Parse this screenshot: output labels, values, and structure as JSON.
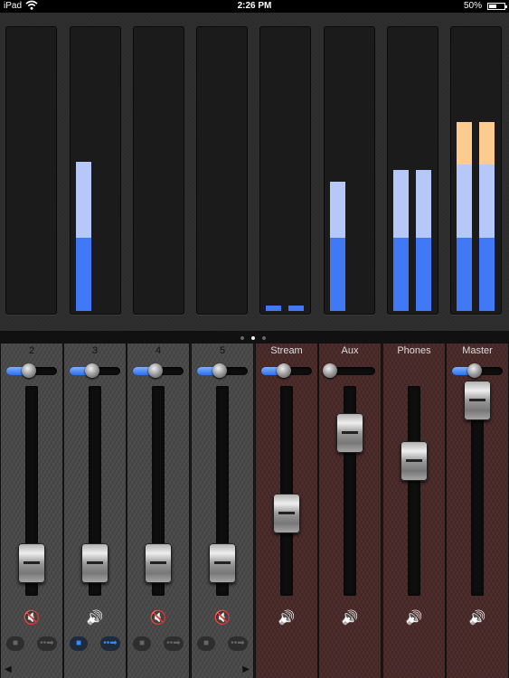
{
  "status_bar": {
    "carrier": "iPad",
    "wifi_icon": "wifi-icon",
    "time": "2:26 PM",
    "battery_pct": "50%"
  },
  "meters": [
    {
      "bars": []
    },
    {
      "bars": [
        {
          "low": 0.26,
          "mid": 0.27,
          "high": 0
        }
      ]
    },
    {
      "bars": []
    },
    {
      "bars": []
    },
    {
      "bars": [
        {
          "low": 0.02,
          "mid": 0,
          "high": 0
        },
        {
          "low": 0.02,
          "mid": 0,
          "high": 0
        }
      ]
    },
    {
      "bars": [
        {
          "low": 0.26,
          "mid": 0.2,
          "high": 0
        }
      ]
    },
    {
      "bars": [
        {
          "low": 0.26,
          "mid": 0.24,
          "high": 0
        },
        {
          "low": 0.26,
          "mid": 0.24,
          "high": 0
        }
      ]
    },
    {
      "bars": [
        {
          "low": 0.26,
          "mid": 0.26,
          "high": 0.15
        },
        {
          "low": 0.26,
          "mid": 0.26,
          "high": 0.15
        }
      ]
    }
  ],
  "meter_colors": {
    "low": "#4178f5",
    "mid": "#b6c8f7",
    "high": "#fbcb8f"
  },
  "pager": {
    "pages": 3,
    "active": 1
  },
  "strips": [
    {
      "label": "2",
      "theme": "gray",
      "pan": 0.45,
      "pan_enabled": true,
      "fader": 0.07,
      "speaker_icon": "speaker-muted-icon",
      "muted": true,
      "show_buttons": true,
      "chat_on": false,
      "send_on": false
    },
    {
      "label": "3",
      "theme": "gray",
      "pan": 0.45,
      "pan_enabled": true,
      "fader": 0.07,
      "speaker_icon": "speaker-icon",
      "muted": false,
      "show_buttons": true,
      "chat_on": true,
      "send_on": true
    },
    {
      "label": "4",
      "theme": "gray",
      "pan": 0.45,
      "pan_enabled": true,
      "fader": 0.07,
      "speaker_icon": "speaker-muted-icon",
      "muted": true,
      "show_buttons": true,
      "chat_on": false,
      "send_on": false
    },
    {
      "label": "5",
      "theme": "gray",
      "pan": 0.45,
      "pan_enabled": true,
      "fader": 0.07,
      "speaker_icon": "speaker-muted-icon",
      "muted": true,
      "show_buttons": true,
      "chat_on": false,
      "send_on": false
    },
    {
      "label": "Stream",
      "theme": "red",
      "pan": 0.45,
      "pan_enabled": true,
      "fader": 0.35,
      "speaker_icon": "speaker-icon",
      "muted": false,
      "show_buttons": false
    },
    {
      "label": "Aux",
      "theme": "red",
      "pan": 0.1,
      "pan_enabled": false,
      "fader": 0.8,
      "speaker_icon": "speaker-icon",
      "muted": false,
      "show_buttons": false
    },
    {
      "label": "Phones",
      "theme": "red",
      "pan": null,
      "pan_enabled": false,
      "fader": 0.64,
      "speaker_icon": "speaker-icon",
      "muted": false,
      "show_buttons": false
    },
    {
      "label": "Master",
      "theme": "red",
      "pan": 0.45,
      "pan_enabled": true,
      "fader": 0.98,
      "speaker_icon": "speaker-icon",
      "muted": false,
      "show_buttons": false
    }
  ],
  "nav": {
    "prev_icon": "scroll-left-icon",
    "next_icon": "scroll-right-icon"
  }
}
